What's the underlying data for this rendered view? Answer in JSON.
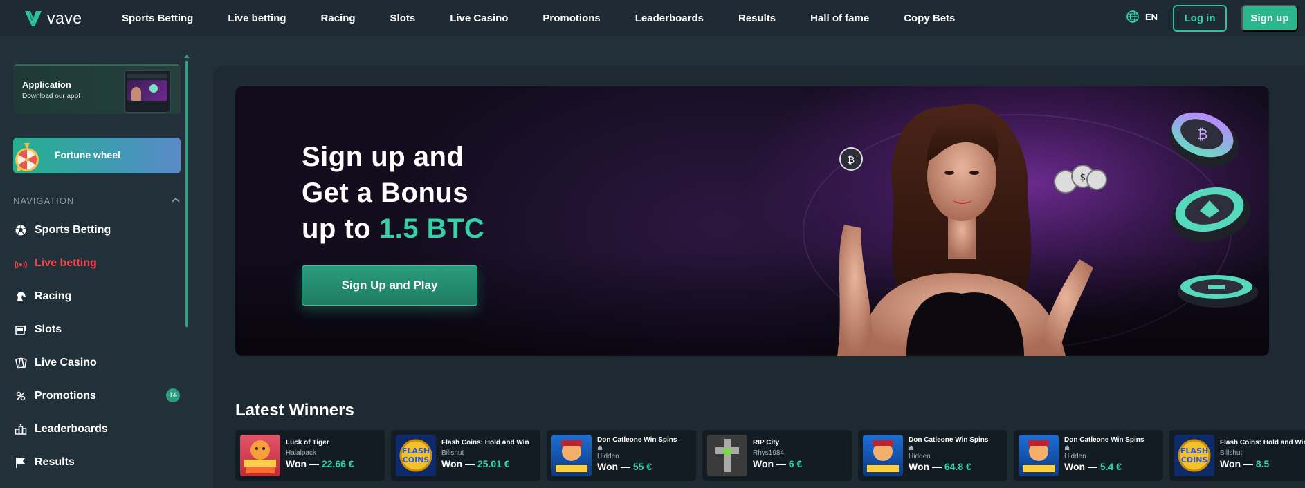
{
  "header": {
    "logo_text": "vave",
    "nav": [
      "Sports Betting",
      "Live betting",
      "Racing",
      "Slots",
      "Live Casino",
      "Promotions",
      "Leaderboards",
      "Results",
      "Hall of fame",
      "Copy Bets"
    ],
    "language": "EN",
    "login_label": "Log in",
    "signup_label": "Sign up"
  },
  "sidebar": {
    "app_card": {
      "title": "Application",
      "subtitle": "Download our app!"
    },
    "fortune_wheel": "Fortune wheel",
    "nav_heading": "NAVIGATION",
    "items": [
      {
        "label": "Sports Betting",
        "icon": "soccer-ball-icon"
      },
      {
        "label": "Live betting",
        "icon": "live-signal-icon",
        "active": true
      },
      {
        "label": "Racing",
        "icon": "horse-head-icon"
      },
      {
        "label": "Slots",
        "icon": "slot-machine-icon"
      },
      {
        "label": "Live Casino",
        "icon": "cards-icon"
      },
      {
        "label": "Promotions",
        "icon": "gift-icon",
        "badge": "14"
      },
      {
        "label": "Leaderboards",
        "icon": "leaderboard-icon"
      },
      {
        "label": "Results",
        "icon": "flag-icon"
      }
    ]
  },
  "hero": {
    "line1": "Sign up and",
    "line2": "Get a Bonus",
    "line3_prefix": "up to",
    "line3_accent": "1.5 BTC",
    "cta": "Sign Up and Play"
  },
  "winners": {
    "title": "Latest Winners",
    "won_prefix": "Won —",
    "items": [
      {
        "game": "Luck of Tiger",
        "user": "Halalpack",
        "amount": "22.66 €",
        "hidden": false
      },
      {
        "game": "Flash Coins: Hold and Win",
        "user": "Billshut",
        "amount": "25.01 €",
        "hidden": false
      },
      {
        "game": "Don Catleone Win Spins",
        "user": "Hidden",
        "amount": "55 €",
        "hidden": true
      },
      {
        "game": "RIP City",
        "user": "Rhys1984",
        "amount": "6 €",
        "hidden": false
      },
      {
        "game": "Don Catleone Win Spins",
        "user": "Hidden",
        "amount": "64.8 €",
        "hidden": true
      },
      {
        "game": "Don Catleone Win Spins",
        "user": "Hidden",
        "amount": "5.4 €",
        "hidden": true
      },
      {
        "game": "Flash Coins: Hold and Win",
        "user": "Billshut",
        "amount": "8.5",
        "hidden": false
      }
    ]
  },
  "colors": {
    "accent": "#35d2a6",
    "active_nav": "#f0454a",
    "background": "#22303a"
  }
}
